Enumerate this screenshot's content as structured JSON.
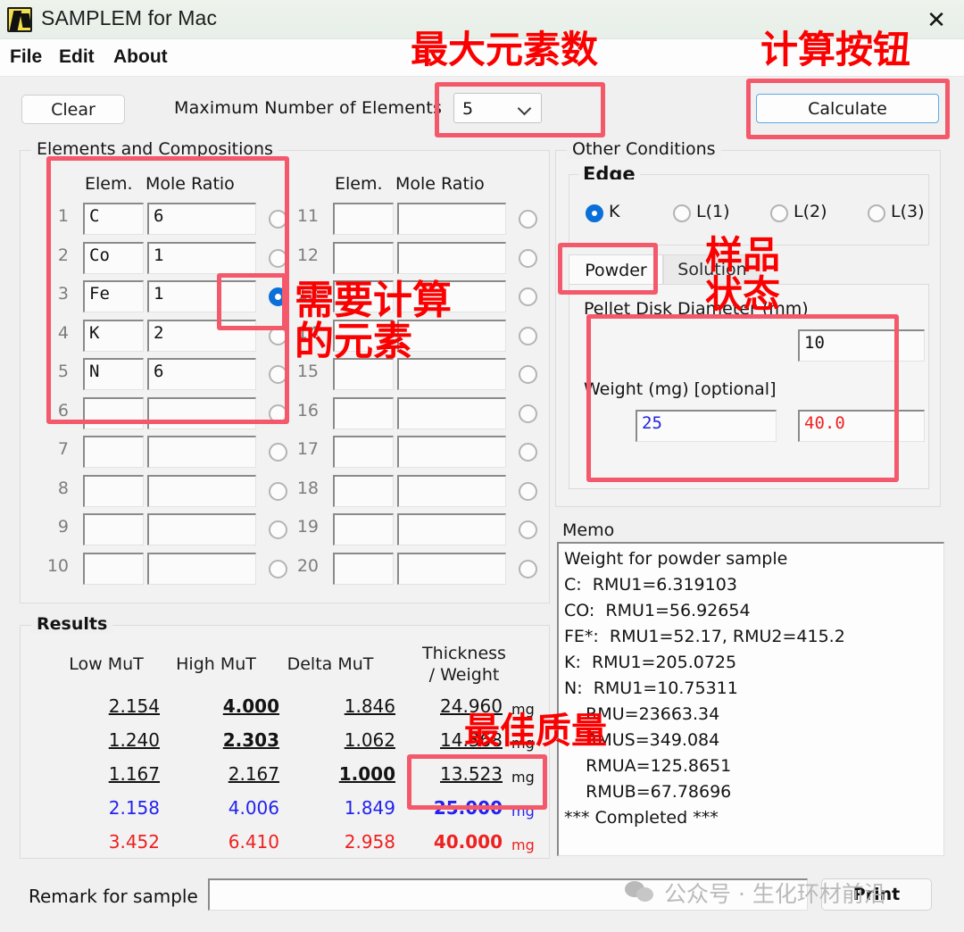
{
  "window": {
    "title": "SAMPLEM for Mac",
    "close_label": "✕",
    "icon": "app-icon"
  },
  "menu": {
    "items": [
      "File",
      "Edit",
      "About"
    ]
  },
  "toolbar": {
    "clear_label": "Clear",
    "max_elements_label": "Maximum Number of Elements",
    "max_elements_value": "5",
    "calculate_label": "Calculate"
  },
  "elements_group": {
    "legend": "Elements and Compositions",
    "col_elem": "Elem.",
    "col_ratio": "Mole Ratio",
    "left_rows": [
      {
        "n": "1",
        "elem": "C",
        "ratio": "6",
        "selected": false
      },
      {
        "n": "2",
        "elem": "Co",
        "ratio": "1",
        "selected": false
      },
      {
        "n": "3",
        "elem": "Fe",
        "ratio": "1",
        "selected": true
      },
      {
        "n": "4",
        "elem": "K",
        "ratio": "2",
        "selected": false
      },
      {
        "n": "5",
        "elem": "N",
        "ratio": "6",
        "selected": false
      },
      {
        "n": "6",
        "elem": "",
        "ratio": "",
        "selected": false
      },
      {
        "n": "7",
        "elem": "",
        "ratio": "",
        "selected": false
      },
      {
        "n": "8",
        "elem": "",
        "ratio": "",
        "selected": false
      },
      {
        "n": "9",
        "elem": "",
        "ratio": "",
        "selected": false
      },
      {
        "n": "10",
        "elem": "",
        "ratio": "",
        "selected": false
      }
    ],
    "right_rows": [
      {
        "n": "11",
        "elem": "",
        "ratio": "",
        "selected": false
      },
      {
        "n": "12",
        "elem": "",
        "ratio": "",
        "selected": false
      },
      {
        "n": "13",
        "elem": "",
        "ratio": "",
        "selected": false
      },
      {
        "n": "14",
        "elem": "",
        "ratio": "",
        "selected": false
      },
      {
        "n": "15",
        "elem": "",
        "ratio": "",
        "selected": false
      },
      {
        "n": "16",
        "elem": "",
        "ratio": "",
        "selected": false
      },
      {
        "n": "17",
        "elem": "",
        "ratio": "",
        "selected": false
      },
      {
        "n": "18",
        "elem": "",
        "ratio": "",
        "selected": false
      },
      {
        "n": "19",
        "elem": "",
        "ratio": "",
        "selected": false
      },
      {
        "n": "20",
        "elem": "",
        "ratio": "",
        "selected": false
      }
    ]
  },
  "other_conditions": {
    "legend": "Other Conditions",
    "edge": {
      "legend": "Edge",
      "options": [
        {
          "label": "K",
          "selected": true
        },
        {
          "label": "L(1)",
          "selected": false
        },
        {
          "label": "L(2)",
          "selected": false
        },
        {
          "label": "L(3)",
          "selected": false
        }
      ]
    },
    "tabs": [
      {
        "label": "Powder",
        "active": true
      },
      {
        "label": "Solution",
        "active": false
      }
    ],
    "powder": {
      "diameter_label": "Pellet Disk Diameter (mm)",
      "diameter_value": "10",
      "weight_label": "Weight (mg) [optional]",
      "weight_value_1": "25",
      "weight_value_2": "40.0",
      "weight_color_1": "#2222dd",
      "weight_color_2": "#ee2222"
    }
  },
  "memo": {
    "legend": "Memo",
    "lines": [
      "Weight for powder sample",
      "C:  RMU1=6.319103",
      "CO:  RMU1=56.92654",
      "FE*:  RMU1=52.17, RMU2=415.2",
      "K:  RMU1=205.0725",
      "N:  RMU1=10.75311",
      "    RMU=23663.34",
      "    RMUS=349.084",
      "    RMUA=125.8651",
      "    RMUB=67.78696",
      "*** Completed ***"
    ]
  },
  "results": {
    "legend": "Results",
    "headers": [
      "Low MuT",
      "High MuT",
      "Delta MuT",
      "Thickness",
      "/ Weight"
    ],
    "unit": "mg",
    "rows": [
      {
        "low": "2.154",
        "high": "4.000",
        "delta": "1.846",
        "weight": "24.960",
        "color": "#131313",
        "bold": [
          false,
          true,
          false,
          false
        ],
        "underline": true
      },
      {
        "low": "1.240",
        "high": "2.303",
        "delta": "1.062",
        "weight": "14.368",
        "color": "#131313",
        "bold": [
          false,
          true,
          false,
          false
        ],
        "underline": true
      },
      {
        "low": "1.167",
        "high": "2.167",
        "delta": "1.000",
        "weight": "13.523",
        "color": "#131313",
        "bold": [
          false,
          false,
          true,
          false
        ],
        "underline": true
      },
      {
        "low": "2.158",
        "high": "4.006",
        "delta": "1.849",
        "weight": "25.000",
        "color": "#2222ee",
        "bold": [
          false,
          false,
          false,
          true
        ],
        "underline": false
      },
      {
        "low": "3.452",
        "high": "6.410",
        "delta": "2.958",
        "weight": "40.000",
        "color": "#ee2020",
        "bold": [
          false,
          false,
          false,
          true
        ],
        "underline": false
      }
    ]
  },
  "bottom": {
    "remark_label": "Remark for sample",
    "remark_value": "",
    "print_label": "Print"
  },
  "watermark": {
    "text": "公众号 · 生化环材前沿"
  },
  "annotations": [
    {
      "id": "max-elements",
      "text": "最大元素数"
    },
    {
      "id": "calc-button",
      "text": "计算按钮"
    },
    {
      "id": "target-element",
      "text": "需要计算\n的元素"
    },
    {
      "id": "sample-state",
      "text": "样品\n状态"
    },
    {
      "id": "best-mass",
      "text": "最佳质量"
    }
  ],
  "colors": {
    "accent": "#0a6fd8",
    "annotation": "#fb0000",
    "annotation_box": "#f4596b"
  }
}
